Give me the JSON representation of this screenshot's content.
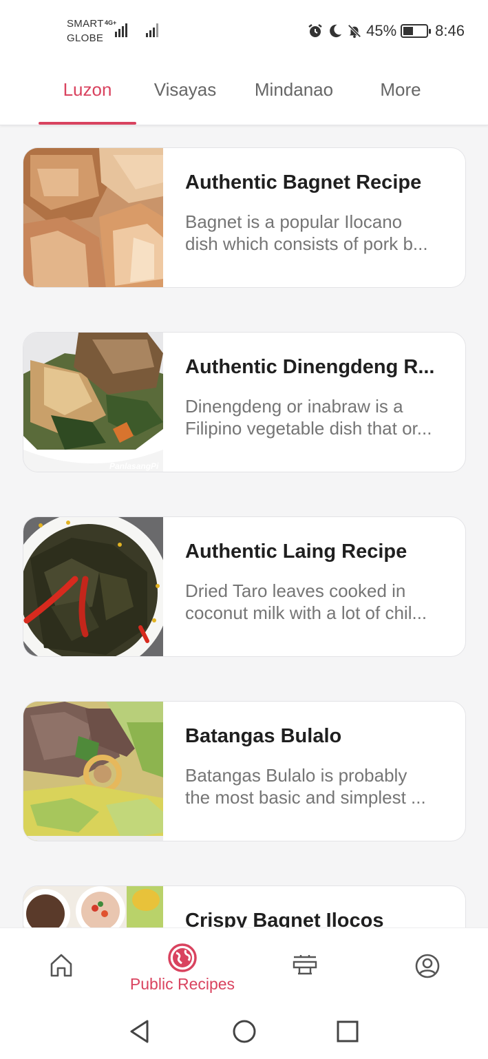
{
  "status_bar": {
    "carrier_line1": "SMART",
    "carrier_line2": "GLOBE",
    "network": "4G+",
    "battery_level": "45%",
    "battery_fraction": 0.45,
    "time": "8:46",
    "icons": [
      "alarm-icon",
      "moon-icon",
      "bell-off-icon",
      "battery-icon"
    ]
  },
  "tabs": [
    {
      "label": "Luzon",
      "active": true
    },
    {
      "label": "Visayas",
      "active": false
    },
    {
      "label": "Mindanao",
      "active": false
    },
    {
      "label": "More",
      "active": false
    }
  ],
  "recipes": [
    {
      "title": "Authentic Bagnet Recipe",
      "desc_line1": "Bagnet is a popular Ilocano",
      "desc_line2": "dish which consists of pork b...",
      "image": "bagnet-photo"
    },
    {
      "title": "Authentic Dinengdeng R...",
      "desc_line1": "Dinengdeng or inabraw is a",
      "desc_line2": "Filipino vegetable dish that or...",
      "image": "dinengdeng-photo",
      "watermark": "PanlasangPi"
    },
    {
      "title": "Authentic Laing Recipe",
      "desc_line1": "Dried Taro leaves cooked in",
      "desc_line2": "coconut milk with a lot of chil...",
      "image": "laing-photo"
    },
    {
      "title": "Batangas Bulalo",
      "desc_line1": "Batangas Bulalo is probably",
      "desc_line2": "the most basic and simplest ...",
      "image": "bulalo-photo"
    },
    {
      "title": "Crispy Bagnet Ilocos",
      "desc_line1": "",
      "desc_line2": "",
      "image": "crispy-bagnet-photo"
    }
  ],
  "bottom_nav": {
    "items": [
      {
        "icon": "home-icon",
        "label": "",
        "active": false
      },
      {
        "icon": "globe-icon",
        "label": "Public Recipes",
        "active": true
      },
      {
        "icon": "recipes-board-icon",
        "label": "",
        "active": false
      },
      {
        "icon": "profile-icon",
        "label": "",
        "active": false
      }
    ]
  },
  "system_nav": [
    "back-icon",
    "home-circle-icon",
    "recents-icon"
  ],
  "colors": {
    "accent": "#d9435f",
    "text": "#1f1f1f",
    "muted": "#757575",
    "background": "#f5f5f6"
  }
}
